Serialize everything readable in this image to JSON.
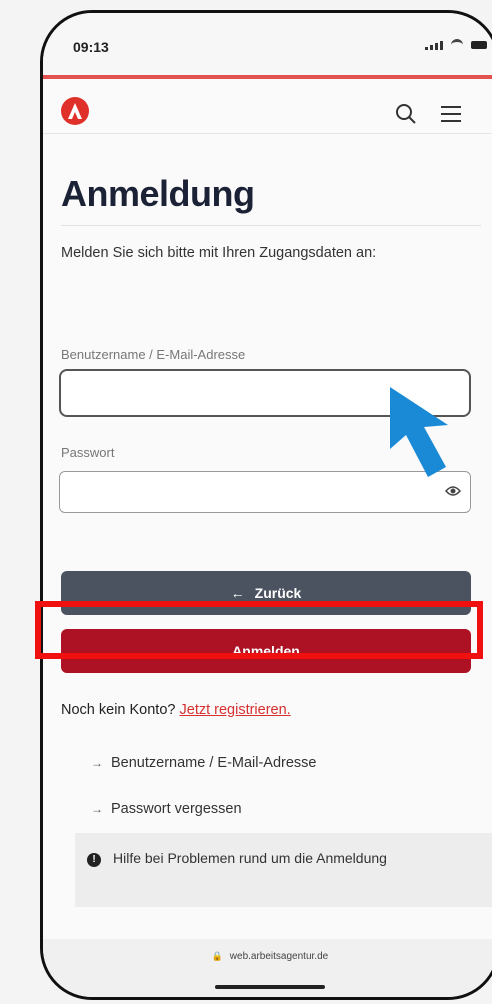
{
  "status_bar": {
    "time": "09:13"
  },
  "header": {
    "logo": "arbeitsagentur-logo",
    "icons": [
      "search-icon",
      "menu-icon"
    ]
  },
  "page": {
    "title": "Anmeldung",
    "intro": "Melden Sie sich bitte mit Ihren Zugangsdaten an:"
  },
  "form": {
    "username_label": "Benutzername / E-Mail-Adresse",
    "username_value": "",
    "password_label": "Passwort",
    "password_value": ""
  },
  "buttons": {
    "back_arrow": "←",
    "back_label": "Zurück",
    "login_label": "Anmelden"
  },
  "register": {
    "prompt": "Noch kein Konto?",
    "link": "Jetzt registrieren."
  },
  "help_links": {
    "arrow": "→",
    "items": [
      "Benutzername / E-Mail-Adresse",
      "Passwort vergessen"
    ]
  },
  "help_box": {
    "icon": "!",
    "text": "Hilfe bei Problemen rund um die Anmeldung"
  },
  "browser": {
    "lock": "🔒",
    "url": "web.arbeitsagentur.de"
  },
  "colors": {
    "accent_red": "#ad1124",
    "back_button": "#4b5361",
    "highlight": "#f01010",
    "cursor": "#1a8ad6"
  }
}
